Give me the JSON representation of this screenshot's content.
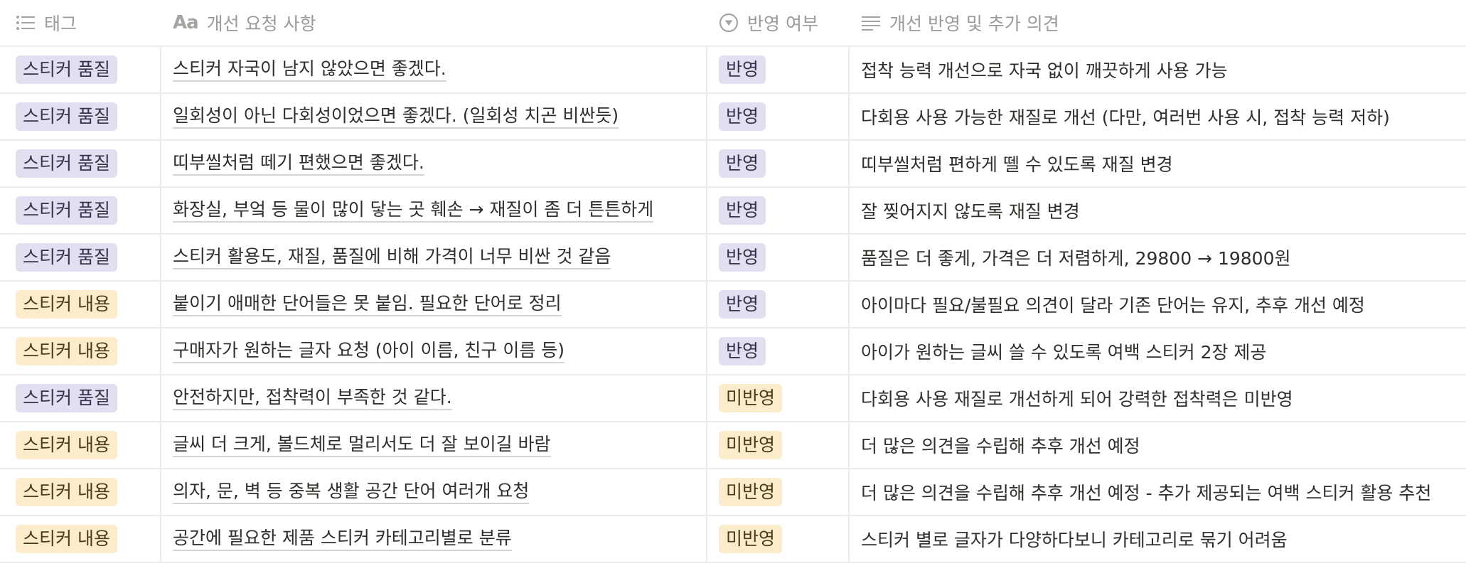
{
  "columns": {
    "tag": "태그",
    "request": "개선 요청 사항",
    "status": "반영 여부",
    "note": "개선 반영 및 추가 의견",
    "request_icon_text": "Aa"
  },
  "icons": {
    "tag": "list-icon",
    "request": "text-aa-icon",
    "status": "status-select-icon",
    "note": "lines-icon"
  },
  "colors": {
    "purple_tag_bg": "#e3def0",
    "yellow_tag_bg": "#fbeccc",
    "grid": "#ececeb",
    "header_text": "#9b9a97"
  },
  "rows": [
    {
      "tag": "스티커 품질",
      "tag_color": "purple",
      "request": "스티커 자국이 남지 않았으면 좋겠다.",
      "status": "반영",
      "status_color": "purple",
      "note": "접착 능력 개선으로 자국 없이 깨끗하게 사용 가능"
    },
    {
      "tag": "스티커 품질",
      "tag_color": "purple",
      "request": "일회성이 아닌 다회성이었으면 좋겠다. (일회성 치곤 비싼듯)",
      "status": "반영",
      "status_color": "purple",
      "note": "다회용 사용 가능한 재질로 개선 (다만, 여러번 사용 시, 접착 능력 저하)"
    },
    {
      "tag": "스티커 품질",
      "tag_color": "purple",
      "request": "띠부씰처럼 떼기 편했으면 좋겠다.",
      "status": "반영",
      "status_color": "purple",
      "note": "띠부씰처럼 편하게 뗄 수 있도록 재질 변경"
    },
    {
      "tag": "스티커 품질",
      "tag_color": "purple",
      "request": "화장실, 부엌 등 물이 많이 닿는 곳 훼손 → 재질이 좀 더 튼튼하게",
      "status": "반영",
      "status_color": "purple",
      "note": "잘 찢어지지 않도록 재질 변경"
    },
    {
      "tag": "스티커 품질",
      "tag_color": "purple",
      "request": "스티커 활용도, 재질, 품질에 비해 가격이 너무 비싼 것 같음",
      "status": "반영",
      "status_color": "purple",
      "note": "품질은 더 좋게, 가격은 더 저렴하게, 29800 → 19800원"
    },
    {
      "tag": "스티커 내용",
      "tag_color": "yellow",
      "request": "붙이기 애매한 단어들은 못 붙임. 필요한 단어로 정리",
      "status": "반영",
      "status_color": "purple",
      "note": "아이마다 필요/불필요 의견이 달라 기존 단어는 유지, 추후 개선 예정"
    },
    {
      "tag": "스티커 내용",
      "tag_color": "yellow",
      "request": "구매자가 원하는 글자 요청 (아이 이름, 친구 이름 등)",
      "status": "반영",
      "status_color": "purple",
      "note": "아이가 원하는 글씨 쓸 수 있도록 여백 스티커 2장 제공"
    },
    {
      "tag": "스티커 품질",
      "tag_color": "purple",
      "request": "안전하지만, 접착력이 부족한 것 같다.",
      "status": "미반영",
      "status_color": "yellow",
      "note": "다회용 사용 재질로 개선하게 되어 강력한 접착력은 미반영"
    },
    {
      "tag": "스티커 내용",
      "tag_color": "yellow",
      "request": "글씨 더 크게, 볼드체로 멀리서도 더 잘 보이길 바람",
      "status": "미반영",
      "status_color": "yellow",
      "note": "더 많은 의견을 수립해 추후 개선 예정"
    },
    {
      "tag": "스티커 내용",
      "tag_color": "yellow",
      "request": "의자, 문, 벽 등 중복 생활 공간 단어 여러개 요청",
      "status": "미반영",
      "status_color": "yellow",
      "note": "더 많은 의견을 수립해 추후 개선 예정 - 추가 제공되는 여백 스티커 활용 추천"
    },
    {
      "tag": "스티커 내용",
      "tag_color": "yellow",
      "request": "공간에 필요한 제품 스티커 카테고리별로 분류",
      "status": "미반영",
      "status_color": "yellow",
      "note": "스티커 별로 글자가 다양하다보니 카테고리로 묶기 어려움"
    }
  ]
}
